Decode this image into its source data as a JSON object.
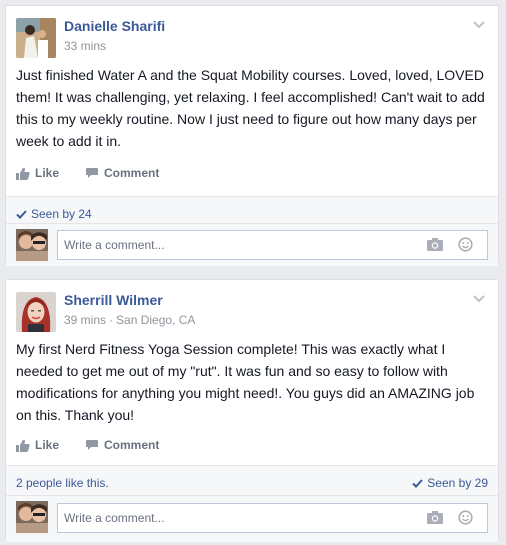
{
  "posts": [
    {
      "author": "Danielle Sharifi",
      "time": "33 mins",
      "location": "",
      "text": "Just finished Water A and the Squat Mobility courses. Loved, loved, LOVED them! It was challenging, yet relaxing. I feel accomplished! Can't wait to add this to my weekly routine. Now I just need to figure out how many days per week to add it in.",
      "like_label": "Like",
      "comment_label": "Comment",
      "likes_text": "",
      "seen_text": "Seen by 24",
      "comment_placeholder": "Write a comment..."
    },
    {
      "author": "Sherrill Wilmer",
      "time": "39 mins",
      "location": "San Diego, CA",
      "separator": "·",
      "text": "My first Nerd Fitness Yoga Session complete! This was exactly what I needed to get me out of my \"rut\". It was fun and so easy to follow with modifications for anything you might need!. You guys did an AMAZING job on this. Thank you!",
      "like_label": "Like",
      "comment_label": "Comment",
      "likes_text": "2 people like this.",
      "seen_text": "Seen by 29",
      "comment_placeholder": "Write a comment..."
    }
  ],
  "icons": {
    "chevron": "chevron-down-icon",
    "like": "thumbs-up-icon",
    "comment": "comment-bubble-icon",
    "seen": "checkmark-icon",
    "camera": "camera-icon",
    "emoji": "smiley-icon"
  },
  "colors": {
    "link": "#3b5998",
    "meta": "#90949c",
    "action": "#6a7180",
    "background": "#e9ebee"
  }
}
